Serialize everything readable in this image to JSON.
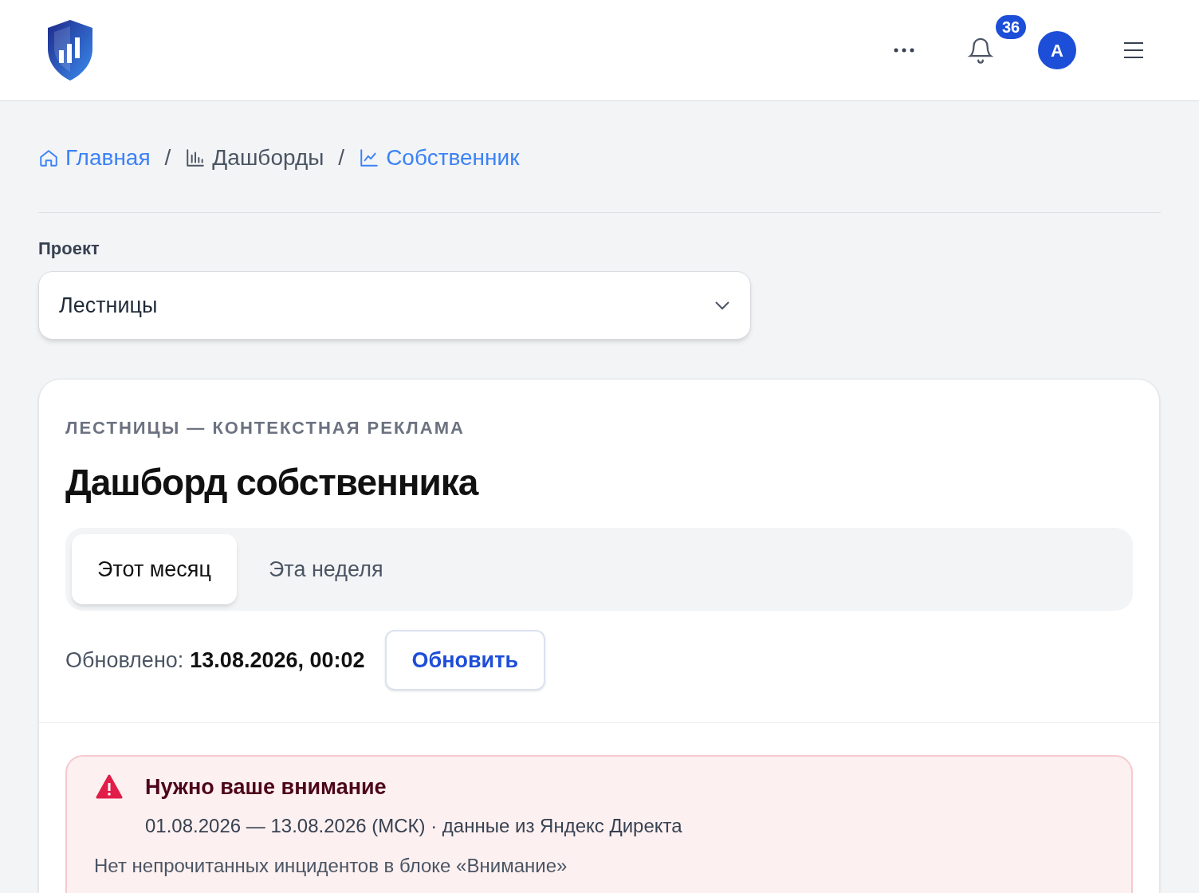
{
  "breadcrumb_separator": "/",
  "header": {
    "notifications_count": "36",
    "avatar_letter": "A"
  },
  "breadcrumbs": [
    {
      "label": "Главная",
      "kind": "home",
      "link": true
    },
    {
      "label": "Дашборды",
      "kind": "bars",
      "link": false
    },
    {
      "label": "Собственник",
      "kind": "line",
      "link": true
    }
  ],
  "project": {
    "label": "Проект",
    "value": "Лестницы"
  },
  "card": {
    "eyebrow": "ЛЕСТНИЦЫ — КОНТЕКСТНАЯ РЕКЛАМА",
    "title": "Дашборд собственника",
    "tabs": [
      {
        "label": "Этот месяц",
        "selected": true
      },
      {
        "label": "Эта неделя",
        "selected": false
      }
    ],
    "updated_label": "Обновлено:",
    "updated_value": "13.08.2026, 00:02",
    "refresh_button": "Обновить",
    "alert": {
      "title": "Нужно ваше внимание",
      "subtitle": "01.08.2026 — 13.08.2026 (МСК) · данные из Яндекс Директа",
      "message": "Нет непрочитанных инцидентов в блоке «Внимание»"
    }
  }
}
